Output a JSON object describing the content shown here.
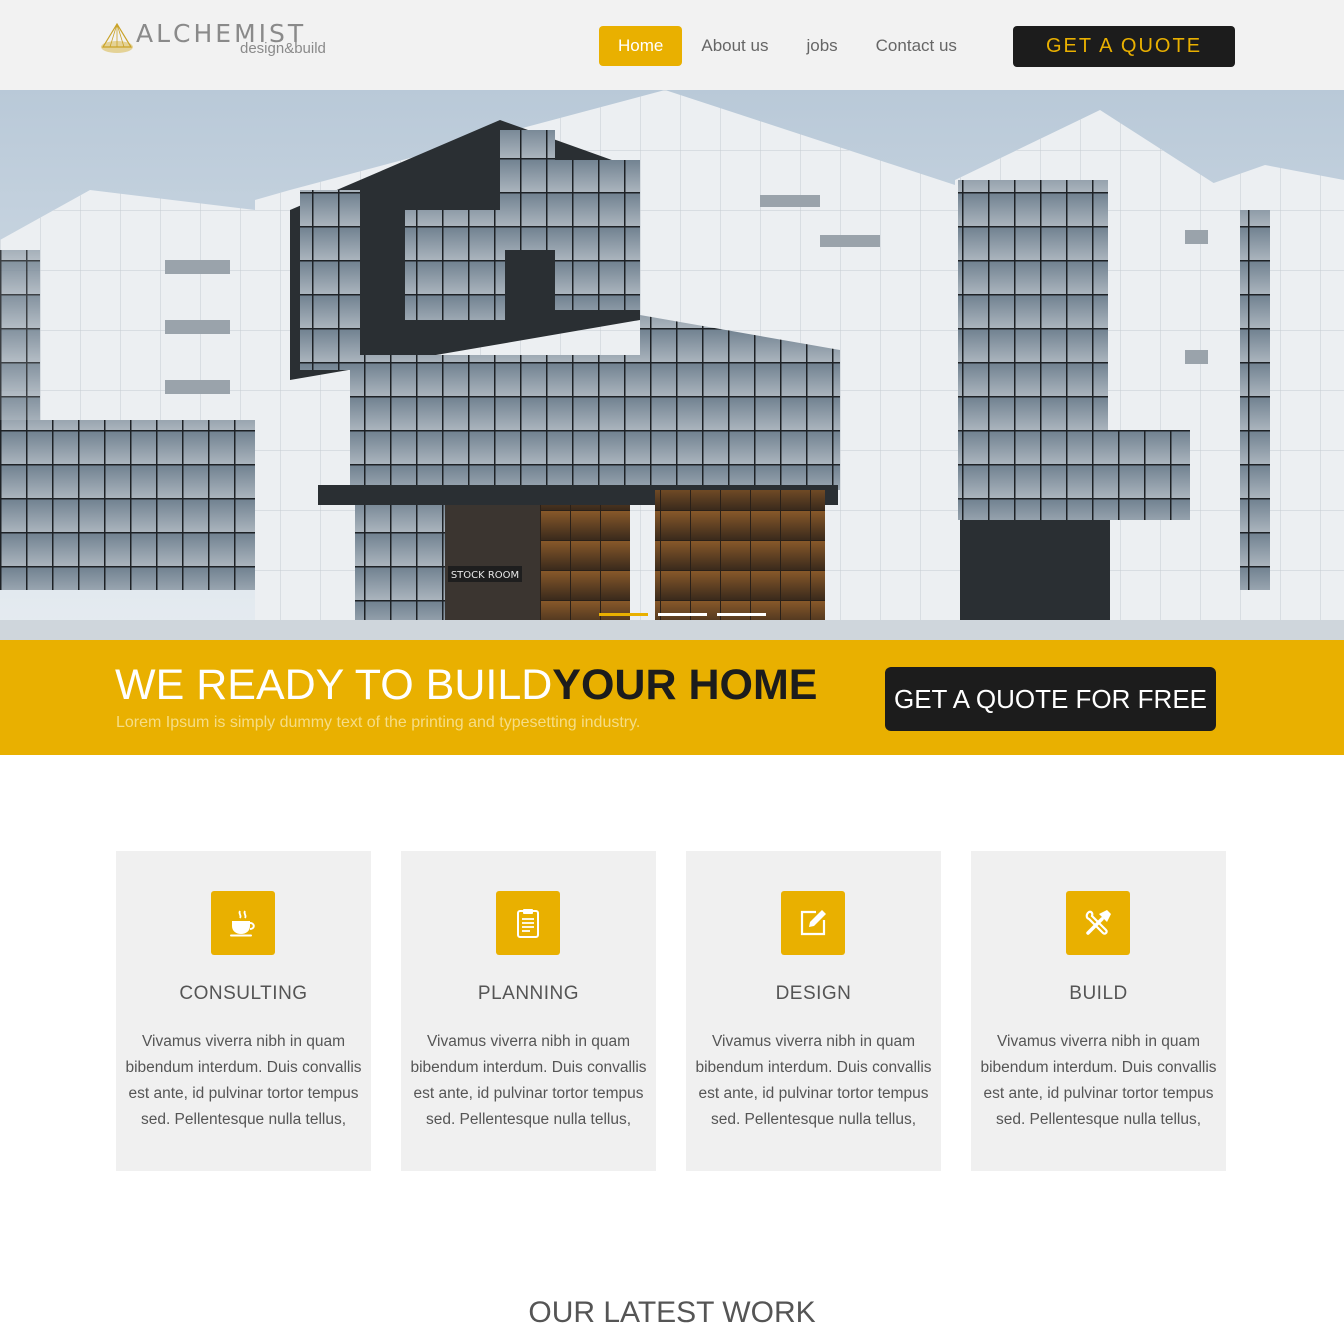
{
  "header": {
    "logo": {
      "name": "ALCHEMIST",
      "tagline": "design&build"
    },
    "nav": [
      {
        "label": "Home",
        "active": true
      },
      {
        "label": "About us",
        "active": false
      },
      {
        "label": "jobs",
        "active": false
      },
      {
        "label": "Contact us",
        "active": false
      }
    ],
    "quote_button": "GET A QUOTE"
  },
  "hero": {
    "image": "modern-building-render",
    "storefront_sign": "STOCK ROOM",
    "slides": 3,
    "active_slide": 1
  },
  "banner": {
    "title_light": "WE READY TO BUILD",
    "title_bold": "YOUR HOME",
    "subtitle": "Lorem Ipsum is simply dummy text of the printing and typesetting industry.",
    "button": "GET A QUOTE FOR FREE"
  },
  "services": [
    {
      "icon": "coffee-cup-icon",
      "title": "CONSULTING",
      "text": "Vivamus viverra nibh in quam bibendum interdum. Duis convallis est ante, id pulvinar tortor tempus sed. Pellentesque nulla tellus,"
    },
    {
      "icon": "clipboard-icon",
      "title": "PLANNING",
      "text": "Vivamus viverra nibh in quam bibendum interdum. Duis convallis est ante, id pulvinar tortor tempus sed. Pellentesque nulla tellus,"
    },
    {
      "icon": "edit-icon",
      "title": "DESIGN",
      "text": "Vivamus viverra nibh in quam bibendum interdum. Duis convallis est ante, id pulvinar tortor tempus sed. Pellentesque nulla tellus,"
    },
    {
      "icon": "tools-icon",
      "title": "BUILD",
      "text": "Vivamus viverra nibh in quam bibendum interdum. Duis convallis est ante, id pulvinar tortor tempus sed. Pellentesque nulla tellus,"
    }
  ],
  "latest_work": {
    "title": "OUR LATEST WORK"
  },
  "colors": {
    "accent": "#e9b000",
    "dark": "#1c1c1c",
    "header_bg": "#f2f2f2",
    "card_bg": "#f0f0f0"
  }
}
